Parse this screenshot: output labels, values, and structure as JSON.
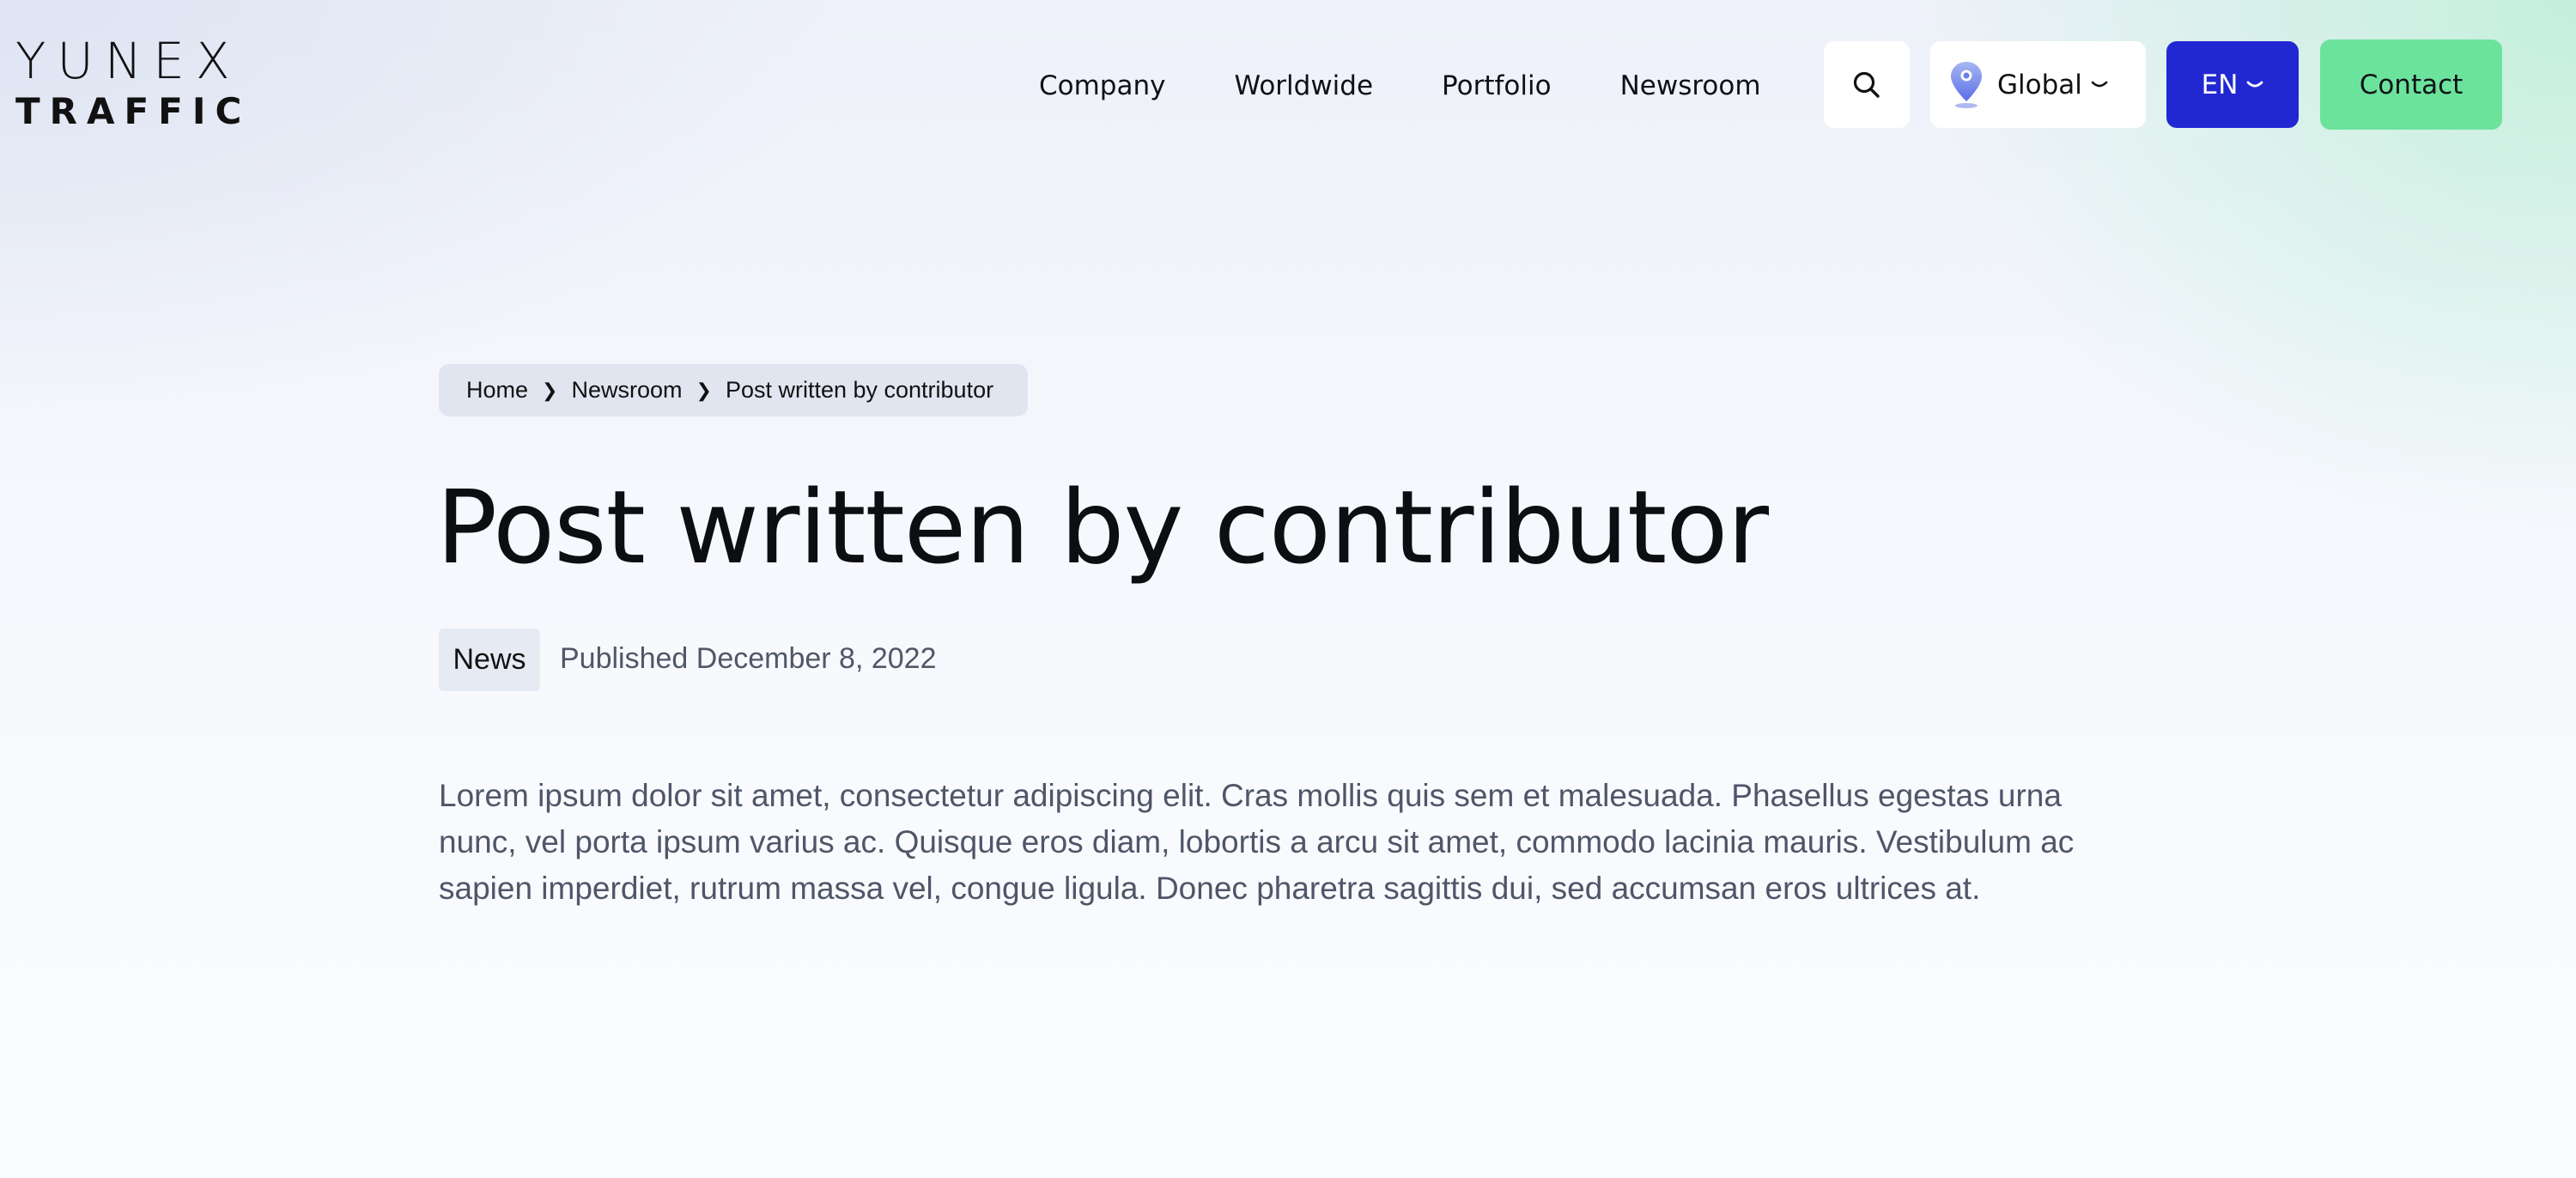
{
  "brand": {
    "logo_line1": "YUNEX",
    "logo_line2": "TRAFFIC"
  },
  "nav": {
    "items": [
      "Company",
      "Worldwide",
      "Portfolio",
      "Newsroom"
    ]
  },
  "header_actions": {
    "search_icon": "search-icon",
    "region_label": "Global",
    "region_icon": "location-pin-icon",
    "language_label": "EN",
    "contact_label": "Contact"
  },
  "breadcrumb": {
    "home": "Home",
    "section": "Newsroom",
    "current": "Post written by contributor",
    "separator": "❯"
  },
  "article": {
    "title": "Post written by contributor",
    "category": "News",
    "published": "Published December 8, 2022",
    "body": "Lorem ipsum dolor sit amet, consectetur adipiscing elit. Cras mollis quis sem et malesuada. Phasellus egestas urna nunc, vel porta ipsum varius ac. Quisque eros diam, lobortis a arcu sit amet, commodo lacinia mauris. Vestibulum ac sapien imperdiet, rutrum massa vel, congue ligula. Donec pharetra sagittis dui, sed accumsan eros ultrices at."
  },
  "colors": {
    "language_button": "#2128d2",
    "contact_button": "#6ce39c",
    "breadcrumb_bg": "#e0e5f0",
    "tag_bg": "#e6eaf3"
  }
}
